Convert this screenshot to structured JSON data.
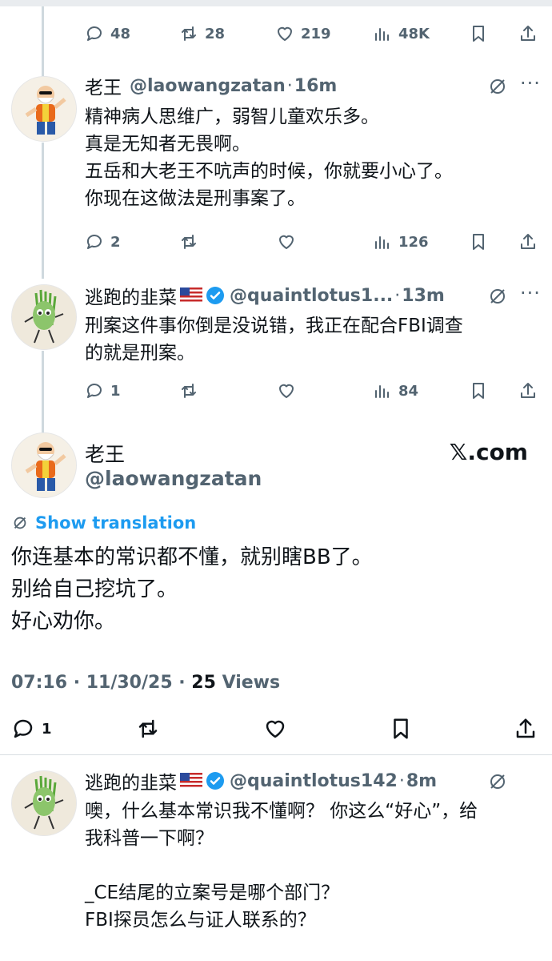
{
  "top_actions": {
    "replies": "48",
    "reposts": "28",
    "likes": "219",
    "views": "48K"
  },
  "reply1": {
    "name": "老王",
    "handle": "@laowangzatan",
    "time": "16m",
    "lines": [
      "精神病人思维广，弱智儿童欢乐多。",
      "真是无知者无畏啊。",
      "五岳和大老王不吭声的时候，你就要小心了。",
      "你现在这做法是刑事案了。"
    ],
    "replies": "2",
    "reposts": "",
    "likes": "",
    "views": "126"
  },
  "reply2": {
    "name": "逃跑的韭菜",
    "handle": "@quaintlotus1...",
    "time": "13m",
    "lines": [
      "刑案这件事你倒是没说错，我正在配合FBI调查",
      "的就是刑案。"
    ],
    "replies": "1",
    "reposts": "",
    "likes": "",
    "views": "84"
  },
  "main_post": {
    "name": "老王",
    "handle": "@laowangzatan",
    "watermark": "𝕏.com",
    "show_translation": "Show translation",
    "lines": [
      "你连基本的常识都不懂，就别瞎BB了。",
      "别给自己挖坑了。",
      "好心劝你。"
    ],
    "timestamp": "07:16 · 11/30/25 · ",
    "views_count": "25",
    "views_label": " Views",
    "replies": "1"
  },
  "reply3": {
    "name": "逃跑的韭菜",
    "handle": "@quaintlotus142",
    "time": "8m",
    "lines": [
      "噢，什么基本常识我不懂啊？ 你这么“好心”，给",
      "我科普一下啊？",
      "",
      "_CE结尾的立案号是哪个部门？",
      "FBI探员怎么与证人联系的？"
    ]
  },
  "colors": {
    "accent": "#1d9bf0",
    "muted": "#536471",
    "text": "#0f1419"
  }
}
